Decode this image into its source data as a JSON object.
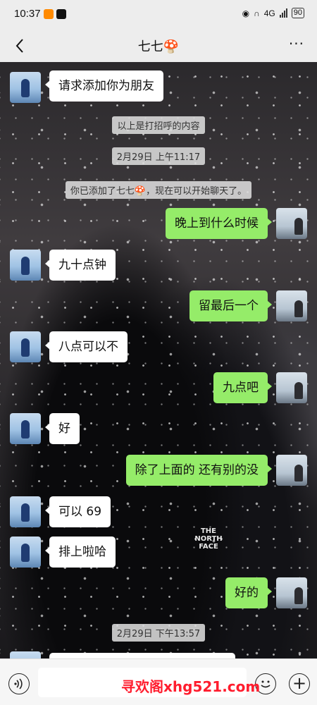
{
  "status_bar": {
    "time": "10:37",
    "net": "4G",
    "battery": "90"
  },
  "header": {
    "title": "七七🍄",
    "more": "···"
  },
  "messages": [
    {
      "type": "in",
      "text": "请求添加你为朋友"
    },
    {
      "type": "system",
      "text": "以上是打招呼的内容"
    },
    {
      "type": "time",
      "text": "2月29日 上午11:17"
    },
    {
      "type": "system",
      "text": "你已添加了七七🍄，现在可以开始聊天了。"
    },
    {
      "type": "out",
      "text": "晚上到什么时候"
    },
    {
      "type": "in",
      "text": "九十点钟"
    },
    {
      "type": "out",
      "text": "留最后一个"
    },
    {
      "type": "in",
      "text": "八点可以不"
    },
    {
      "type": "out",
      "text": "九点吧"
    },
    {
      "type": "in",
      "text": "好"
    },
    {
      "type": "out",
      "text": "除了上面的 还有别的没"
    },
    {
      "type": "in",
      "text": "可以 69"
    },
    {
      "type": "in",
      "text": "排上啦哈"
    },
    {
      "type": "out",
      "text": "好的"
    },
    {
      "type": "time",
      "text": "2月29日 下午13:57"
    }
  ],
  "wallpaper_text": "THE NORTH FACE",
  "watermark": "寻欢阁xhg521.com"
}
